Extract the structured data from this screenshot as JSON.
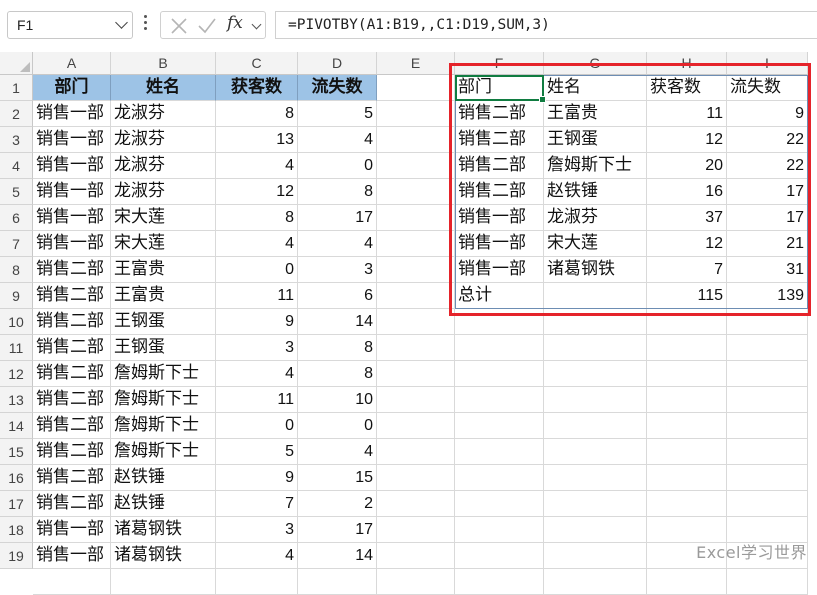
{
  "formula_bar": {
    "name_box": "F1",
    "fx_label": "fx",
    "formula": "=PIVOTBY(A1:B19,,C1:D19,SUM,3)"
  },
  "columns": [
    "A",
    "B",
    "C",
    "D",
    "E",
    "F",
    "G",
    "H",
    "I"
  ],
  "rows": [
    "1",
    "2",
    "3",
    "4",
    "5",
    "6",
    "7",
    "8",
    "9",
    "10",
    "11",
    "12",
    "13",
    "14",
    "15",
    "16",
    "17",
    "18",
    "19"
  ],
  "source_table": {
    "headers": [
      "部门",
      "姓名",
      "获客数",
      "流失数"
    ],
    "rows": [
      [
        "销售一部",
        "龙淑芬",
        "8",
        "5"
      ],
      [
        "销售一部",
        "龙淑芬",
        "13",
        "4"
      ],
      [
        "销售一部",
        "龙淑芬",
        "4",
        "0"
      ],
      [
        "销售一部",
        "龙淑芬",
        "12",
        "8"
      ],
      [
        "销售一部",
        "宋大莲",
        "8",
        "17"
      ],
      [
        "销售一部",
        "宋大莲",
        "4",
        "4"
      ],
      [
        "销售二部",
        "王富贵",
        "0",
        "3"
      ],
      [
        "销售二部",
        "王富贵",
        "11",
        "6"
      ],
      [
        "销售二部",
        "王钢蛋",
        "9",
        "14"
      ],
      [
        "销售二部",
        "王钢蛋",
        "3",
        "8"
      ],
      [
        "销售二部",
        "詹姆斯下士",
        "4",
        "8"
      ],
      [
        "销售二部",
        "詹姆斯下士",
        "11",
        "10"
      ],
      [
        "销售二部",
        "詹姆斯下士",
        "0",
        "0"
      ],
      [
        "销售二部",
        "詹姆斯下士",
        "5",
        "4"
      ],
      [
        "销售二部",
        "赵铁锤",
        "9",
        "15"
      ],
      [
        "销售二部",
        "赵铁锤",
        "7",
        "2"
      ],
      [
        "销售一部",
        "诸葛钢铁",
        "3",
        "17"
      ],
      [
        "销售一部",
        "诸葛钢铁",
        "4",
        "14"
      ]
    ]
  },
  "pivot_table": {
    "headers": [
      "部门",
      "姓名",
      "获客数",
      "流失数"
    ],
    "rows": [
      [
        "销售二部",
        "王富贵",
        "11",
        "9"
      ],
      [
        "销售二部",
        "王钢蛋",
        "12",
        "22"
      ],
      [
        "销售二部",
        "詹姆斯下士",
        "20",
        "22"
      ],
      [
        "销售二部",
        "赵铁锤",
        "16",
        "17"
      ],
      [
        "销售一部",
        "龙淑芬",
        "37",
        "17"
      ],
      [
        "销售一部",
        "宋大莲",
        "12",
        "21"
      ],
      [
        "销售一部",
        "诸葛钢铁",
        "7",
        "31"
      ],
      [
        "总计",
        "",
        "115",
        "139"
      ]
    ]
  },
  "watermark": "Excel学习世界",
  "colors": {
    "header_fill": "#9dc3e6",
    "highlight_border": "#e5232a",
    "active_cell": "#107c41"
  }
}
